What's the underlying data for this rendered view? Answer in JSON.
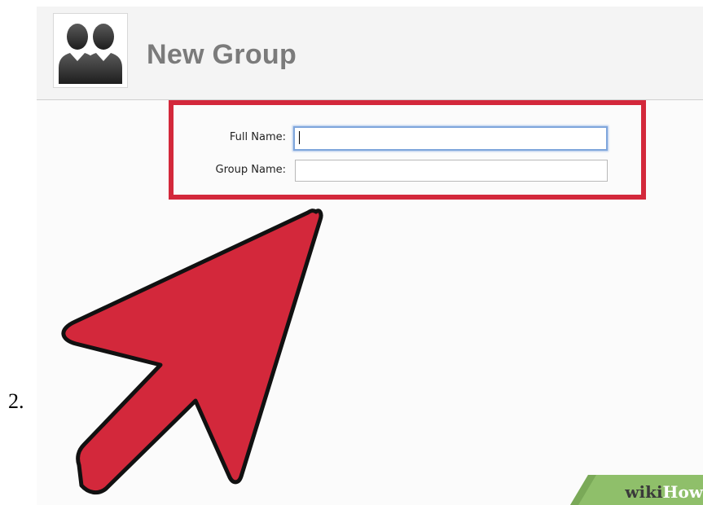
{
  "step": {
    "number": "2."
  },
  "header": {
    "title": "New Group",
    "avatar_icon": "group-silhouette-icon"
  },
  "form": {
    "full_name": {
      "label": "Full Name:",
      "value": "",
      "focused": true
    },
    "group_name": {
      "label": "Group Name:",
      "value": ""
    }
  },
  "annotation": {
    "highlight_color": "#d3283b",
    "arrow_icon": "pointer-arrow-icon",
    "arrow_color": "#d3283b"
  },
  "watermark": {
    "part1": "wiki",
    "part2": "How",
    "badge_color": "#8fbf6a"
  }
}
